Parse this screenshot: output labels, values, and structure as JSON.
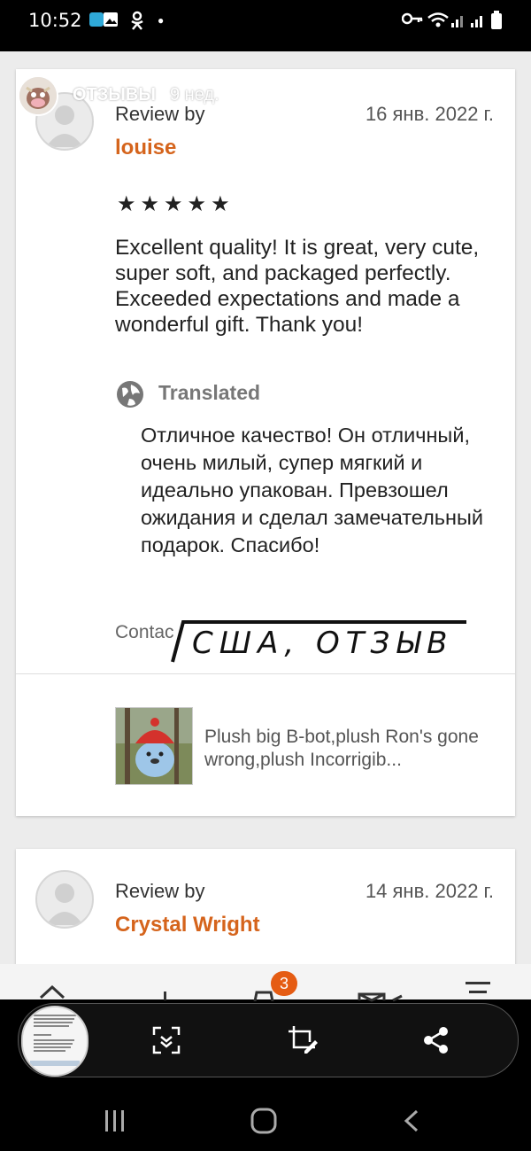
{
  "status_bar": {
    "time": "10:52"
  },
  "story": {
    "title": "ОТЗЫВЫ",
    "age": "9 нед."
  },
  "review1": {
    "review_by": "Review by",
    "date": "16 янв. 2022 г.",
    "reviewer": "louise",
    "stars": "★★★★★",
    "rating": 5,
    "text": "Excellent quality! It is great, very cute, super soft, and packaged perfectly. Exceeded expectations and made a wonderful gift. Thank you!",
    "translated_label": "Translated",
    "translated_text": "Отличное качество! Он отличный, очень милый, супер мягкий и идеально упакован. Превзошел ожидания и сделал замечательный подарок. Спасибо!",
    "contact": "Contac",
    "listing_title": "Plush big B-bot,plush Ron's gone wrong,plush Incorrigib..."
  },
  "sticker": {
    "text": "США, ОТЗЫВ"
  },
  "review2": {
    "review_by": "Review by",
    "date": "14 янв. 2022 г.",
    "reviewer": "Crystal Wright"
  },
  "bottom_nav": {
    "cart_badge": "3"
  }
}
